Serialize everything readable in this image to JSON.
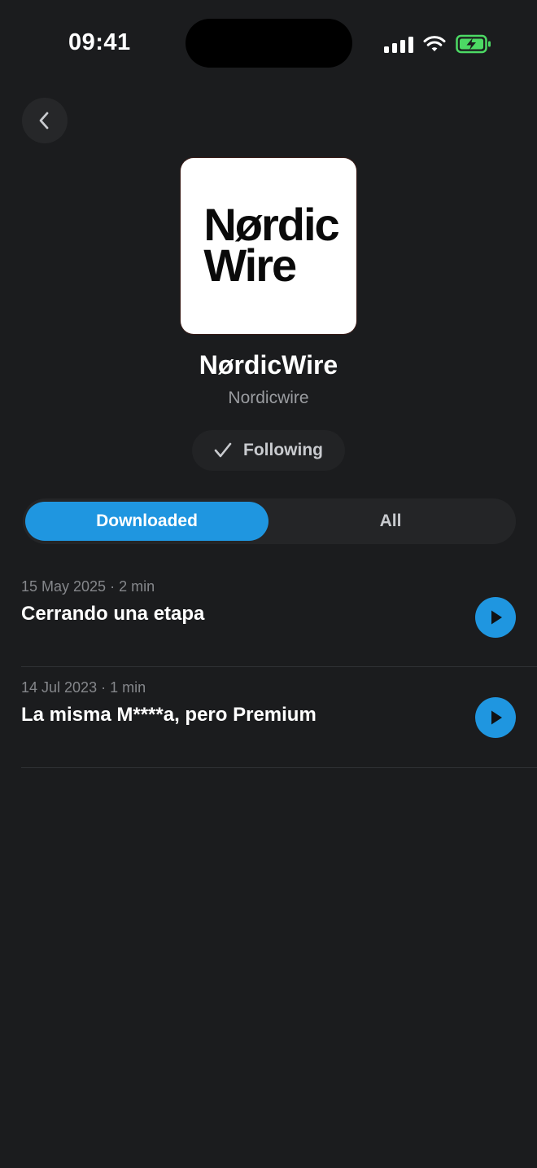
{
  "status_bar": {
    "time": "09:41",
    "icons": [
      "cellular-signal-icon",
      "wifi-icon",
      "battery-charging-icon"
    ]
  },
  "header": {
    "back_icon": "chevron-left-icon"
  },
  "show": {
    "logo_line1": "Nørdic",
    "logo_line2": "Wire",
    "title": "NørdicWire",
    "author": "Nordicwire",
    "follow_label": "Following",
    "follow_icon": "checkmark-icon"
  },
  "tabs": {
    "items": [
      {
        "label": "Downloaded",
        "selected": true
      },
      {
        "label": "All",
        "selected": false
      }
    ]
  },
  "episodes": [
    {
      "meta": "15 May 2025 · 2 min",
      "title": "Cerrando una etapa",
      "icon": "play-icon"
    },
    {
      "meta": "14 Jul 2023 · 1 min",
      "title": "La misma M****a, pero Premium",
      "icon": "play-icon"
    }
  ],
  "colors": {
    "background": "#1b1c1e",
    "accent": "#1f96e0",
    "battery_charge": "#4cd964"
  }
}
